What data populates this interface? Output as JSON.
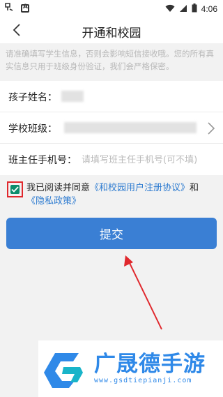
{
  "status_bar": {
    "time": "4:06"
  },
  "header": {
    "title": "开通和校园"
  },
  "notice": "请准确填写学生信息，否则会影响短信接收哦。您的所有真实信息只用于班级身份验证，我们会严格保密。",
  "form": {
    "child_name_label": "孩子姓名：",
    "school_class_label": "学校班级：",
    "teacher_phone_label": "班主任手机号：",
    "teacher_phone_placeholder": "请填写班主任手机号(可不填)"
  },
  "agreement": {
    "prefix": "我已阅读并同意",
    "user_agreement_link": "《和校园用户注册协议》",
    "conjunction": "和",
    "privacy_link": "《隐私政策》",
    "checked": true
  },
  "submit_label": "提交",
  "watermark": {
    "brand": "广晟德手游",
    "url": "www.gsdtiepianji.com"
  },
  "colors": {
    "accent": "#3a7fd4",
    "checkbox": "#0c8c6c",
    "highlight": "#e0282d"
  }
}
